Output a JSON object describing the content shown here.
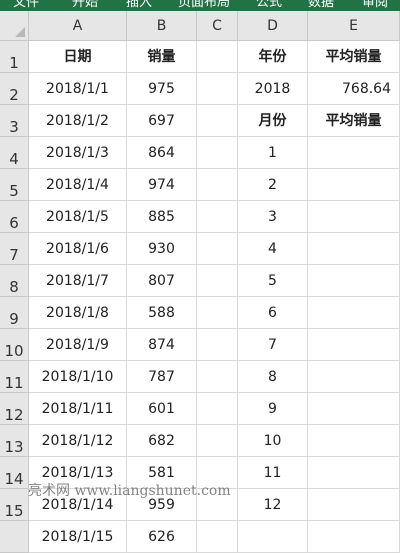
{
  "ribbon": {
    "tabs": [
      "文件",
      "开始",
      "插入",
      "页面布局",
      "公式",
      "数据",
      "审阅"
    ]
  },
  "colors": {
    "ribbon": "#217346",
    "header_bg": "#e6e6e6",
    "gridline": "#d9d9d9"
  },
  "columns": [
    "A",
    "B",
    "C",
    "D",
    "E"
  ],
  "rows": [
    "1",
    "2",
    "3",
    "4",
    "5",
    "6",
    "7",
    "8",
    "9",
    "10",
    "11",
    "12",
    "13",
    "14",
    "15",
    ""
  ],
  "cells": [
    {
      "col": "A",
      "row": 1,
      "value": "日期",
      "align": "center",
      "bold": true
    },
    {
      "col": "B",
      "row": 1,
      "value": "销量",
      "align": "center",
      "bold": true
    },
    {
      "col": "D",
      "row": 1,
      "value": "年份",
      "align": "center",
      "bold": true
    },
    {
      "col": "E",
      "row": 1,
      "value": "平均销量",
      "align": "center",
      "bold": true
    },
    {
      "col": "A",
      "row": 2,
      "value": "2018/1/1",
      "align": "center"
    },
    {
      "col": "B",
      "row": 2,
      "value": "975",
      "align": "center"
    },
    {
      "col": "D",
      "row": 2,
      "value": "2018",
      "align": "center"
    },
    {
      "col": "E",
      "row": 2,
      "value": "768.64",
      "align": "right"
    },
    {
      "col": "A",
      "row": 3,
      "value": "2018/1/2",
      "align": "center"
    },
    {
      "col": "B",
      "row": 3,
      "value": "697",
      "align": "center"
    },
    {
      "col": "D",
      "row": 3,
      "value": "月份",
      "align": "center",
      "bold": true
    },
    {
      "col": "E",
      "row": 3,
      "value": "平均销量",
      "align": "center",
      "bold": true
    },
    {
      "col": "A",
      "row": 4,
      "value": "2018/1/3",
      "align": "center"
    },
    {
      "col": "B",
      "row": 4,
      "value": "864",
      "align": "center"
    },
    {
      "col": "D",
      "row": 4,
      "value": "1",
      "align": "center"
    },
    {
      "col": "A",
      "row": 5,
      "value": "2018/1/4",
      "align": "center"
    },
    {
      "col": "B",
      "row": 5,
      "value": "974",
      "align": "center"
    },
    {
      "col": "D",
      "row": 5,
      "value": "2",
      "align": "center"
    },
    {
      "col": "A",
      "row": 6,
      "value": "2018/1/5",
      "align": "center"
    },
    {
      "col": "B",
      "row": 6,
      "value": "885",
      "align": "center"
    },
    {
      "col": "D",
      "row": 6,
      "value": "3",
      "align": "center"
    },
    {
      "col": "A",
      "row": 7,
      "value": "2018/1/6",
      "align": "center"
    },
    {
      "col": "B",
      "row": 7,
      "value": "930",
      "align": "center"
    },
    {
      "col": "D",
      "row": 7,
      "value": "4",
      "align": "center"
    },
    {
      "col": "A",
      "row": 8,
      "value": "2018/1/7",
      "align": "center"
    },
    {
      "col": "B",
      "row": 8,
      "value": "807",
      "align": "center"
    },
    {
      "col": "D",
      "row": 8,
      "value": "5",
      "align": "center"
    },
    {
      "col": "A",
      "row": 9,
      "value": "2018/1/8",
      "align": "center"
    },
    {
      "col": "B",
      "row": 9,
      "value": "588",
      "align": "center"
    },
    {
      "col": "D",
      "row": 9,
      "value": "6",
      "align": "center"
    },
    {
      "col": "A",
      "row": 10,
      "value": "2018/1/9",
      "align": "center"
    },
    {
      "col": "B",
      "row": 10,
      "value": "874",
      "align": "center"
    },
    {
      "col": "D",
      "row": 10,
      "value": "7",
      "align": "center"
    },
    {
      "col": "A",
      "row": 11,
      "value": "2018/1/10",
      "align": "center"
    },
    {
      "col": "B",
      "row": 11,
      "value": "787",
      "align": "center"
    },
    {
      "col": "D",
      "row": 11,
      "value": "8",
      "align": "center"
    },
    {
      "col": "A",
      "row": 12,
      "value": "2018/1/11",
      "align": "center"
    },
    {
      "col": "B",
      "row": 12,
      "value": "601",
      "align": "center"
    },
    {
      "col": "D",
      "row": 12,
      "value": "9",
      "align": "center"
    },
    {
      "col": "A",
      "row": 13,
      "value": "2018/1/12",
      "align": "center"
    },
    {
      "col": "B",
      "row": 13,
      "value": "682",
      "align": "center"
    },
    {
      "col": "D",
      "row": 13,
      "value": "10",
      "align": "center"
    },
    {
      "col": "A",
      "row": 14,
      "value": "2018/1/13",
      "align": "center"
    },
    {
      "col": "B",
      "row": 14,
      "value": "581",
      "align": "center"
    },
    {
      "col": "D",
      "row": 14,
      "value": "11",
      "align": "center"
    },
    {
      "col": "A",
      "row": 15,
      "value": "2018/1/14",
      "align": "center"
    },
    {
      "col": "B",
      "row": 15,
      "value": "959",
      "align": "center"
    },
    {
      "col": "D",
      "row": 15,
      "value": "12",
      "align": "center"
    },
    {
      "col": "A",
      "row": 16,
      "value": "2018/1/15",
      "align": "center"
    },
    {
      "col": "B",
      "row": 16,
      "value": "626",
      "align": "center"
    }
  ],
  "watermark": "亮术网 www.liangshunet.com"
}
